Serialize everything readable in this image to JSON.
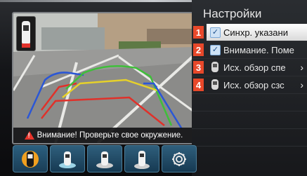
{
  "camera": {
    "warning_text": "Внимание! Проверьте свое окружение."
  },
  "settings": {
    "title": "Настройки",
    "items": [
      {
        "number": "1",
        "label": "Синхр. указани",
        "checked": true,
        "selected": true
      },
      {
        "number": "2",
        "label": "Внимание. Поме",
        "checked": true,
        "selected": false
      },
      {
        "number": "3",
        "label": "Исх. обзор спе",
        "icon": "rear-camera-icon",
        "chevron": "›"
      },
      {
        "number": "4",
        "label": "Исх. обзор сзс",
        "icon": "rear-camera-icon",
        "chevron": "›"
      }
    ]
  },
  "toolbar": {
    "buttons": [
      {
        "icon": "car-top-view-icon",
        "active": true
      },
      {
        "icon": "car-rear-view-icon",
        "active": false
      },
      {
        "icon": "car-side-view-icon",
        "active": false
      },
      {
        "icon": "car-top-rear-view-icon",
        "active": false
      },
      {
        "icon": "gear-icon",
        "active": false
      }
    ]
  },
  "colors": {
    "accent_number": "#e8482a",
    "guide_red": "#e0312a",
    "guide_yellow": "#e6d12a",
    "guide_green": "#3fbf3a",
    "guide_blue": "#2b57d6"
  }
}
